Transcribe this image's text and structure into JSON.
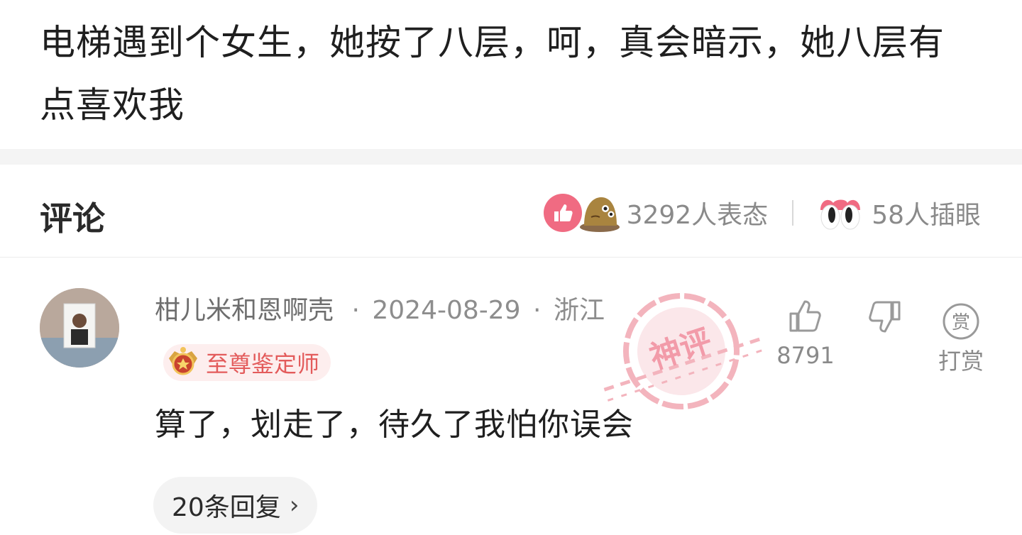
{
  "post": {
    "text": "电梯遇到个女生，她按了八层，呵，真会暗示，她八层有点喜欢我"
  },
  "comments_header": {
    "title": "评论",
    "reactions": [
      {
        "icon": "thumbs-up-icon",
        "count_label": "3292人表态"
      },
      {
        "icon": "eyes-icon",
        "count_label": "58人插眼"
      }
    ]
  },
  "comment": {
    "author": "柑儿米和恩啊壳",
    "date": "2024-08-29",
    "location": "浙江",
    "separator": "·",
    "badge": "至尊鉴定师",
    "text": "算了，划走了，待久了我怕你误会",
    "like_count": "8791",
    "tip_icon_label": "赏",
    "tip_label": "打赏",
    "replies_label": "20条回复",
    "replies_chevron": "›",
    "stamp_text": "神评"
  },
  "colors": {
    "accent_pink": "#f06b82",
    "badge_text": "#e35b5b",
    "muted_text": "#8a8a8a"
  }
}
